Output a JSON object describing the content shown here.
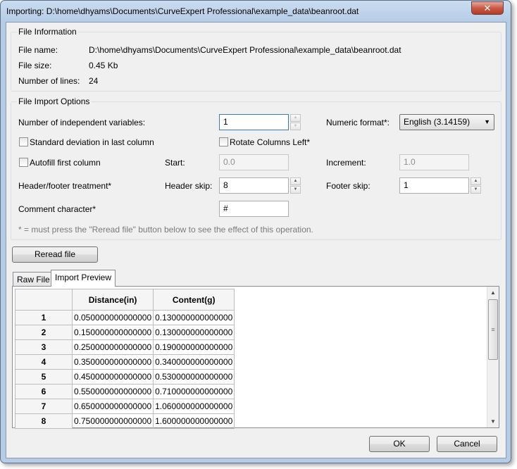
{
  "window": {
    "title": "Importing: D:\\home\\dhyams\\Documents\\CurveExpert Professional\\example_data\\beanroot.dat",
    "close_symbol": "✕"
  },
  "file_info": {
    "group_title": "File Information",
    "name_label": "File name:",
    "name_value": "D:\\home\\dhyams\\Documents\\CurveExpert Professional\\example_data\\beanroot.dat",
    "size_label": "File size:",
    "size_value": "0.45 Kb",
    "lines_label": "Number of lines:",
    "lines_value": "24"
  },
  "options": {
    "group_title": "File Import Options",
    "indep_label": "Number of independent variables:",
    "indep_value": "1",
    "numeric_label": "Numeric format*:",
    "numeric_value": "English (3.14159)",
    "stddev_label": "Standard deviation in last column",
    "rotate_label": "Rotate Columns Left*",
    "autofill_label": "Autofill first column",
    "start_label": "Start:",
    "start_value": "0.0",
    "increment_label": "Increment:",
    "increment_value": "1.0",
    "header_footer_label": "Header/footer treatment*",
    "header_skip_label": "Header skip:",
    "header_skip_value": "8",
    "footer_skip_label": "Footer skip:",
    "footer_skip_value": "1",
    "comment_label": "Comment character*",
    "comment_value": "#",
    "note": "* = must press the \"Reread file\" button below to see the effect of this operation."
  },
  "reread_label": "Reread file",
  "tabs": [
    "Raw File",
    "Import Preview"
  ],
  "preview": {
    "columns": [
      "Distance(in)",
      "Content(g)"
    ],
    "rows": [
      {
        "n": "1",
        "a": "0.050000000000000",
        "b": "0.130000000000000"
      },
      {
        "n": "2",
        "a": "0.150000000000000",
        "b": "0.130000000000000"
      },
      {
        "n": "3",
        "a": "0.250000000000000",
        "b": "0.190000000000000"
      },
      {
        "n": "4",
        "a": "0.350000000000000",
        "b": "0.340000000000000"
      },
      {
        "n": "5",
        "a": "0.450000000000000",
        "b": "0.530000000000000"
      },
      {
        "n": "6",
        "a": "0.550000000000000",
        "b": "0.710000000000000"
      },
      {
        "n": "7",
        "a": "0.650000000000000",
        "b": "1.060000000000000"
      },
      {
        "n": "8",
        "a": "0.750000000000000",
        "b": "1.600000000000000"
      }
    ]
  },
  "buttons": {
    "ok": "OK",
    "cancel": "Cancel"
  }
}
